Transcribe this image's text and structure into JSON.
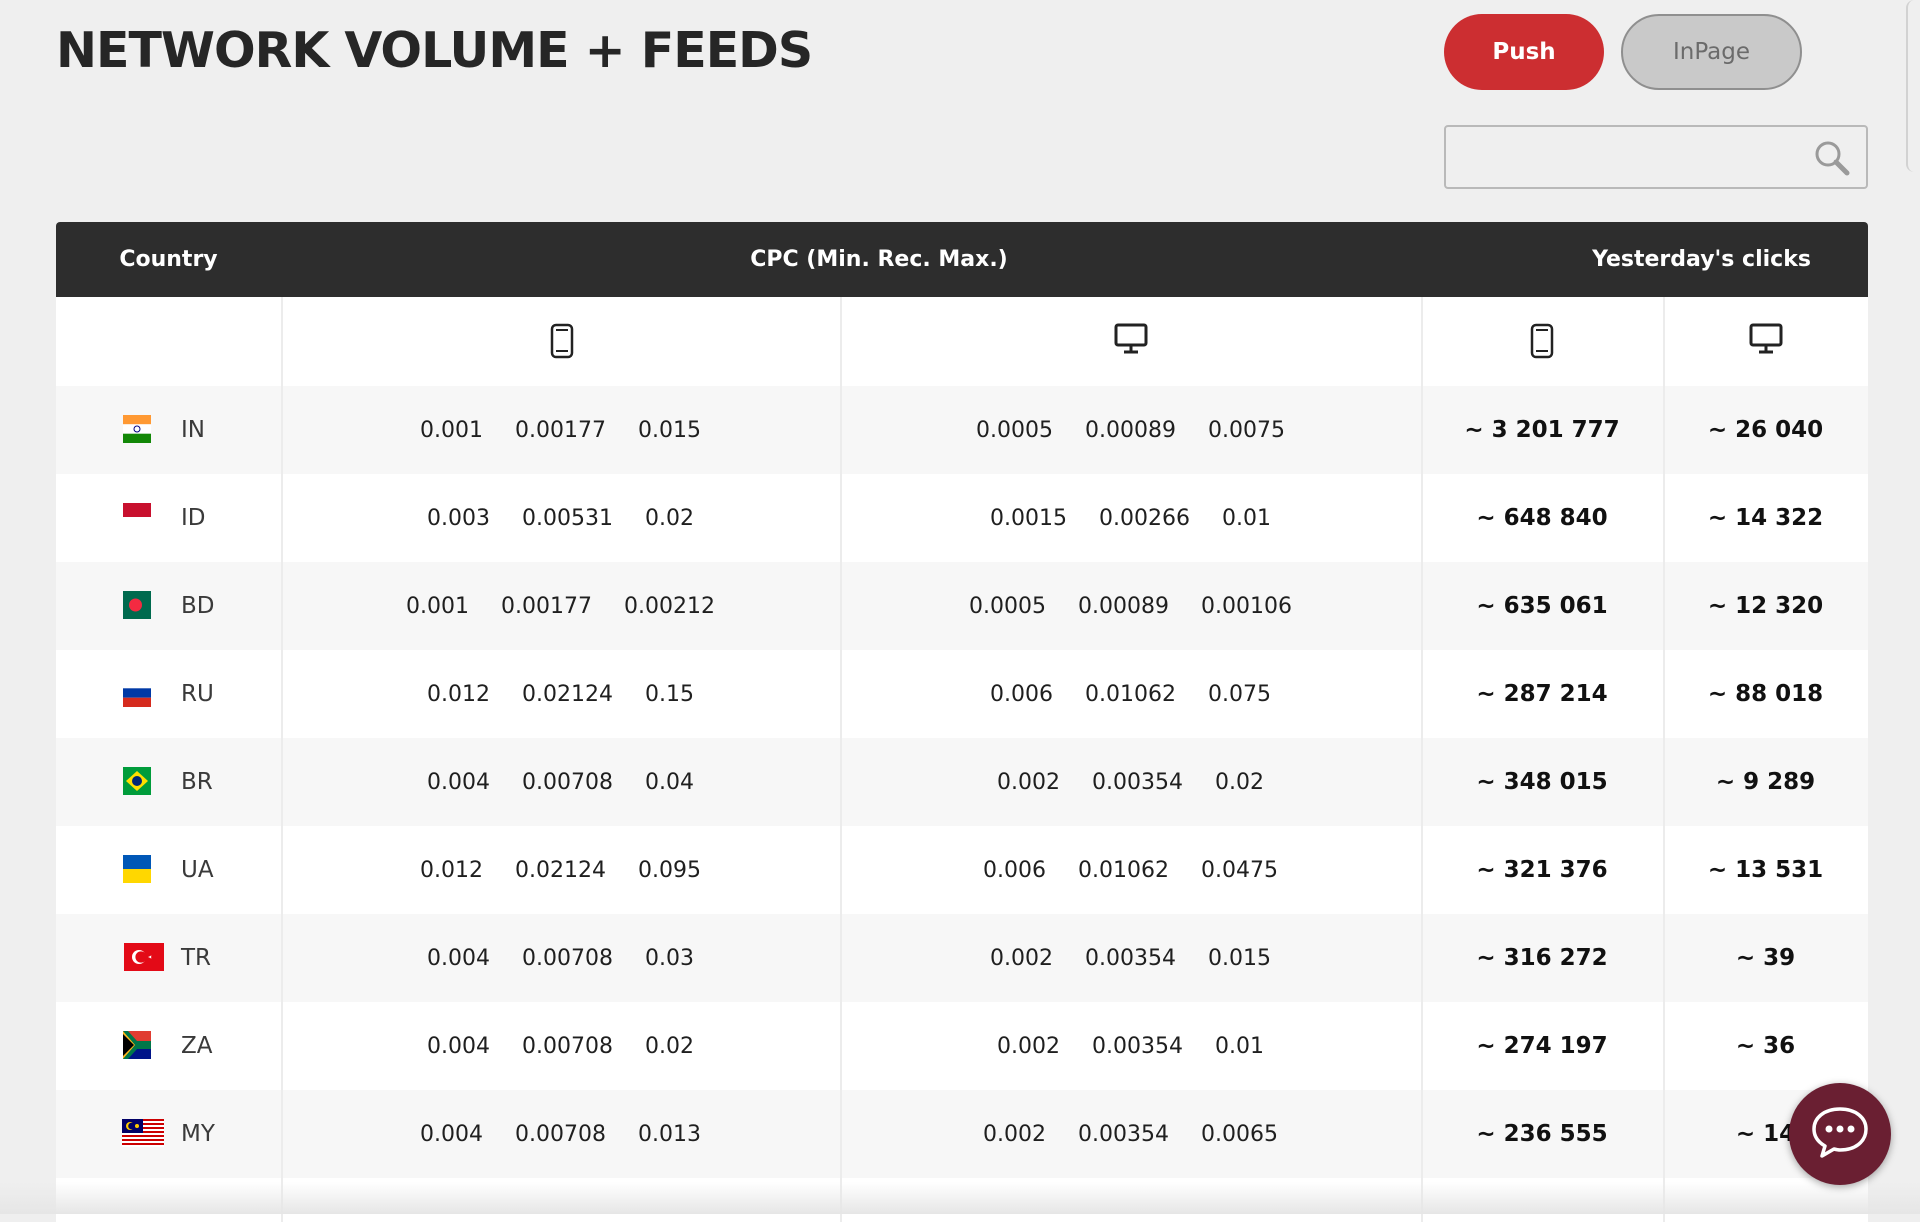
{
  "page": {
    "title": "NETWORK VOLUME + FEEDS"
  },
  "format_buttons": {
    "push_label": "Push",
    "inpage_label": "InPage"
  },
  "search": {
    "value": "",
    "placeholder": ""
  },
  "table": {
    "headers": {
      "country": "Country",
      "cpc": "CPC (Min. Rec. Max.)",
      "clicks": "Yesterday's clicks"
    },
    "subheader_icons": [
      "mobile-icon",
      "desktop-icon",
      "mobile-icon",
      "desktop-icon"
    ],
    "rows": [
      {
        "code": "IN",
        "flag": "flag-in-icon",
        "mobile_cpc": [
          "0.001",
          "0.00177",
          "0.015"
        ],
        "desktop_cpc": [
          "0.0005",
          "0.00089",
          "0.0075"
        ],
        "mobile_clicks": "~ 3 201 777",
        "desktop_clicks": "~ 26 040"
      },
      {
        "code": "ID",
        "flag": "flag-id-icon",
        "mobile_cpc": [
          "0.003",
          "0.00531",
          "0.02"
        ],
        "desktop_cpc": [
          "0.0015",
          "0.00266",
          "0.01"
        ],
        "mobile_clicks": "~ 648 840",
        "desktop_clicks": "~ 14 322"
      },
      {
        "code": "BD",
        "flag": "flag-bd-icon",
        "mobile_cpc": [
          "0.001",
          "0.00177",
          "0.00212"
        ],
        "desktop_cpc": [
          "0.0005",
          "0.00089",
          "0.00106"
        ],
        "mobile_clicks": "~ 635 061",
        "desktop_clicks": "~ 12 320"
      },
      {
        "code": "RU",
        "flag": "flag-ru-icon",
        "mobile_cpc": [
          "0.012",
          "0.02124",
          "0.15"
        ],
        "desktop_cpc": [
          "0.006",
          "0.01062",
          "0.075"
        ],
        "mobile_clicks": "~ 287 214",
        "desktop_clicks": "~ 88 018"
      },
      {
        "code": "BR",
        "flag": "flag-br-icon",
        "mobile_cpc": [
          "0.004",
          "0.00708",
          "0.04"
        ],
        "desktop_cpc": [
          "0.002",
          "0.00354",
          "0.02"
        ],
        "mobile_clicks": "~ 348 015",
        "desktop_clicks": "~ 9 289"
      },
      {
        "code": "UA",
        "flag": "flag-ua-icon",
        "mobile_cpc": [
          "0.012",
          "0.02124",
          "0.095"
        ],
        "desktop_cpc": [
          "0.006",
          "0.01062",
          "0.0475"
        ],
        "mobile_clicks": "~ 321 376",
        "desktop_clicks": "~ 13 531"
      },
      {
        "code": "TR",
        "flag": "flag-tr-icon",
        "mobile_cpc": [
          "0.004",
          "0.00708",
          "0.03"
        ],
        "desktop_cpc": [
          "0.002",
          "0.00354",
          "0.015"
        ],
        "mobile_clicks": "~ 316 272",
        "desktop_clicks": "~ 39"
      },
      {
        "code": "ZA",
        "flag": "flag-za-icon",
        "mobile_cpc": [
          "0.004",
          "0.00708",
          "0.02"
        ],
        "desktop_cpc": [
          "0.002",
          "0.00354",
          "0.01"
        ],
        "mobile_clicks": "~ 274 197",
        "desktop_clicks": "~ 36"
      },
      {
        "code": "MY",
        "flag": "flag-my-icon",
        "mobile_cpc": [
          "0.004",
          "0.00708",
          "0.013"
        ],
        "desktop_cpc": [
          "0.002",
          "0.00354",
          "0.0065"
        ],
        "mobile_clicks": "~ 236 555",
        "desktop_clicks": "~ 14"
      }
    ]
  },
  "chat": {
    "icon": "chat-bubble-icon"
  },
  "colors": {
    "accent_red": "#cc2e31",
    "header_dark": "#2d2d2d",
    "chat_maroon": "#6a1f32"
  }
}
